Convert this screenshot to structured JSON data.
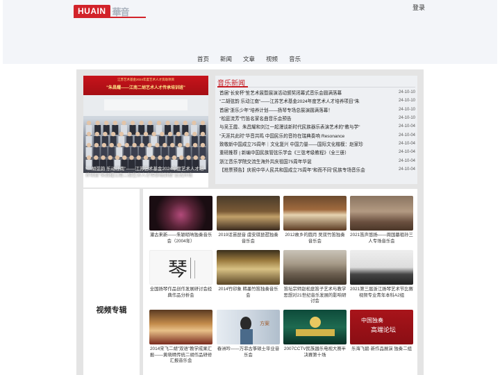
{
  "header": {
    "logo_text": "HUAIN",
    "logo_cn": "華音",
    "login": "登录",
    "nav": [
      "首页",
      "新闻",
      "文章",
      "视频",
      "音乐"
    ]
  },
  "carousel": {
    "banner_line1": "江苏艺术基金2024年度艺术人才资助项目",
    "banner_line2": "\"朱昌耀——江南二胡艺术人才传承培训班\"",
    "caption": "\"二胡弦韵 乐动江南\"——江苏艺术基金2024年度艺术人才培养项目\"朱昌耀江南二胡艺术人才传承培训班\"正式开班"
  },
  "news": {
    "title": "音乐新闻",
    "items": [
      {
        "text": "首届\"长安杯\"笙艺术展暨展演活动颁奖闭幕式音乐会圆满落幕",
        "date": "24-10-10"
      },
      {
        "text": "\"二胡弦韵 乐动江南\"——江苏艺术基金2024年度艺术人才培养项目\"朱",
        "date": "24-10-10"
      },
      {
        "text": "首届\"浙乐少年\"培养计划——扬琴专场总展演圆满落幕！",
        "date": "24-10-10"
      },
      {
        "text": "\"松庭流芳\"竹笛名家名曲音乐会预告",
        "date": "24-10-10"
      },
      {
        "text": "与吴王霞、朱昌耀和刘江一起漫谈新时代民族器乐表演艺术的\"教与学\"",
        "date": "24-10-04"
      },
      {
        "text": "\"天涯共此时\"华音共鸣 中国民乐的音符在瑞典奏响 Resonance",
        "date": "24-10-04"
      },
      {
        "text": "致敬新中国成立75周年｜文化复兴 中国力量——国际文化楷模：赵家珍",
        "date": "24-10-04"
      },
      {
        "text": "重磅推荐 | 新编中国民族管弦乐学会《三弦考级教程》（全三册）",
        "date": "24-10-04"
      },
      {
        "text": "浙江音乐学院交流生海外共庆祖国75周年华诞",
        "date": "24-10-04"
      },
      {
        "text": "【抢票预告】庆祝中华人民共和国成立75周年\"和而不同\"民族专场音乐会",
        "date": "24-10-04"
      }
    ]
  },
  "video": {
    "label": "视频专辑",
    "items": [
      {
        "caption": "灌古来新——朱颖唢呐独奏音乐会（2004年）"
      },
      {
        "caption": "2019话苗琵音 虞安琪琵琶独奏音乐会"
      },
      {
        "caption": "2012故乡的圆月 吴双竹笛独奏音乐会"
      },
      {
        "caption": "2021笛声悠扬——周国墓祖孙三人专场音乐会"
      },
      {
        "caption": "全国扬琴作品创作发展研讨会经典作品分析会"
      },
      {
        "caption": "2014竹印象 韩墨竹笛独奏音乐会"
      },
      {
        "caption": "笛坛宗师赵松庭笛子艺术与教学思想对21世纪音乐发展的影响研讨会"
      },
      {
        "caption": "2021第三届浙江扬琴艺术节比赛视频专业青年本科A2组"
      },
      {
        "caption": "2014宋飞二胡\"双语\"教学成果汇报——黄晓晴传统二胡作品研修汇报音乐会"
      },
      {
        "caption": "春洲吟——万菲古筝硕士毕业音乐会"
      },
      {
        "caption": "2007CCTV民族器乐电视大赛半决赛第十场"
      },
      {
        "caption": "乐海飞碧·新作品展演 独奏二组"
      }
    ],
    "thumb_art": {
      "7": "Chinese calligraphy 琴",
      "9": "方案",
      "10": "KV器乐大赛",
      "11": "中国独奏 高端论坛"
    }
  },
  "colors": {
    "accent": "#c51c23",
    "panel": "#e4e4e4",
    "header_bg": "#f3f5f9"
  }
}
